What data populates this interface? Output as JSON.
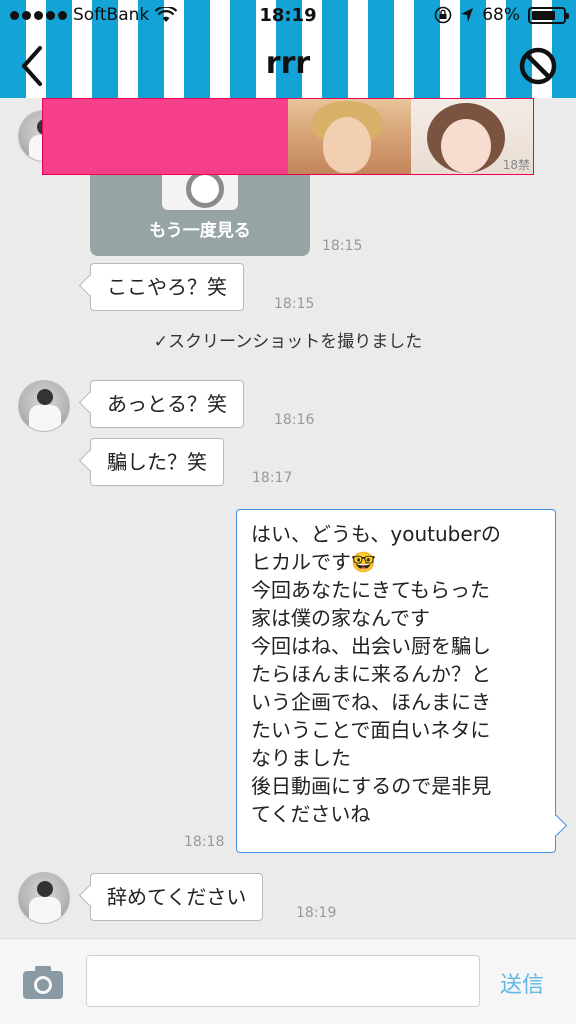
{
  "status_bar": {
    "carrier": "SoftBank",
    "time": "18:19",
    "battery": "68%",
    "battery_level": 0.68
  },
  "nav": {
    "title": "rrr",
    "back_icon": "chevron-left-icon",
    "block_icon": "block-icon"
  },
  "ad": {
    "badge": "18禁"
  },
  "messages": {
    "image": {
      "caption": "もう一度見る",
      "time": "18:15"
    },
    "m1": {
      "text": "ここやろ？笑",
      "time": "18:15"
    },
    "system": "✓スクリーンショットを撮りました",
    "m2": {
      "text": "あっとる？笑",
      "time": "18:16"
    },
    "m3": {
      "text": "騙した？笑",
      "time": "18:17"
    },
    "m4": {
      "lines": [
        "はい、どうも、youtuberの",
        "ヒカルです🤓",
        "今回あなたにきてもらった",
        "家は僕の家なんです",
        "今回はね、出会い厨を騙し",
        "たらほんまに来るんか？と",
        "いう企画でね、ほんまにき",
        "たいうことで面白いネタに",
        "なりました",
        "後日動画にするので是非見",
        "てくださいね"
      ],
      "time": "18:18"
    },
    "m5": {
      "text": "辞めてください",
      "time": "18:19"
    }
  },
  "footer": {
    "input_placeholder": "",
    "send_label": "送信"
  },
  "colors": {
    "header_stripe": "#14a3d6",
    "send": "#62b7e3",
    "own_bubble_border": "#4a90e2",
    "ad_pink": "#f53f8a"
  }
}
